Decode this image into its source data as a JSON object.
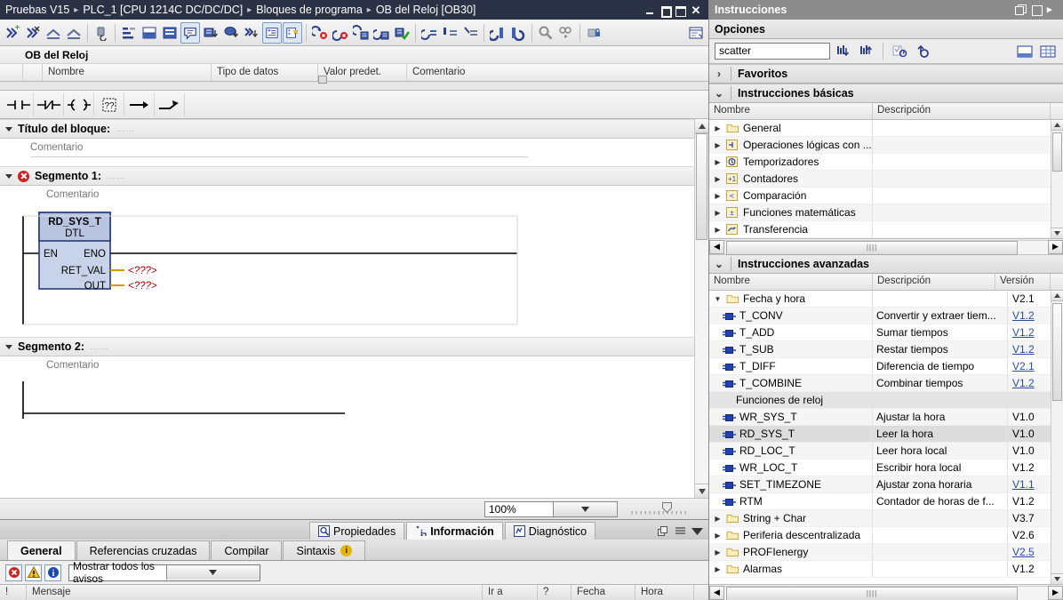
{
  "titlebar": {
    "breadcrumbs": [
      "Pruebas V15",
      "PLC_1 [CPU 1214C DC/DC/DC]",
      "Bloques de programa",
      "OB del Reloj [OB30]"
    ],
    "separator": "▸",
    "controls": [
      {
        "name": "minimize",
        "label": "_"
      },
      {
        "name": "restore",
        "label": ""
      },
      {
        "name": "maximize",
        "label": ""
      },
      {
        "name": "close",
        "label": "✕"
      }
    ]
  },
  "toolbar": {
    "groups": [
      [
        "insert-network-icon",
        "delete-network-icon",
        "up-arrow-network-icon",
        "down-arrow-network-icon"
      ],
      [
        "download-icon"
      ],
      [
        "absolute-symbolic-icon",
        "layout-a-icon",
        "layout-b-icon",
        "comment-toggle-icon",
        "show-disabled-icon",
        "favorites-icon",
        "expand-all-icon",
        "bookmark-icon"
      ],
      [
        "monitor-off-icon",
        "monitor-icon",
        "snapshot-icon",
        "restore-snapshot-icon",
        "modify-icon"
      ],
      [
        "bookmark-prev-icon",
        "bookmark-toggle-icon",
        "bookmark-next-icon"
      ],
      [
        "goto-prev-icon",
        "goto-next-icon"
      ],
      [
        "search-icon",
        "goto-icon"
      ],
      [
        "protect-icon"
      ],
      [
        "properties-icon"
      ]
    ]
  },
  "block": {
    "title": "OB del Reloj",
    "interface_columns": [
      "",
      "",
      "Nombre",
      "Tipo de datos",
      "Valor predet.",
      "Comentario"
    ]
  },
  "lad_tools": [
    {
      "name": "contact-no-icon",
      "label": "-| |-"
    },
    {
      "name": "contact-nc-icon",
      "label": "-|/|-"
    },
    {
      "name": "coil-icon",
      "label": "-( )-"
    },
    {
      "name": "empty-box-icon",
      "label": "??"
    },
    {
      "name": "open-branch-icon",
      "label": "→"
    },
    {
      "name": "close-branch-icon",
      "label": "↗"
    }
  ],
  "editor": {
    "block_title_label": "Título del bloque:",
    "block_comment": "Comentario",
    "dots": "……",
    "networks": [
      {
        "label": "Segmento 1:",
        "comment": "Comentario",
        "has_error": true
      },
      {
        "label": "Segmento 2:",
        "comment": "Comentario",
        "has_error": false
      }
    ],
    "fb": {
      "name": "RD_SYS_T",
      "type": "DTL",
      "left_pins": [
        "EN"
      ],
      "right_pins": [
        "ENO",
        "RET_VAL",
        "OUT"
      ],
      "ret_val_value": "<???>",
      "out_value": "<???>"
    },
    "zoom": {
      "value": "100%"
    }
  },
  "info_panel": {
    "tabs": [
      {
        "label": "Propiedades",
        "icon": "properties-icon",
        "active": false
      },
      {
        "label": "Información",
        "icon": "info-icon",
        "active": true
      },
      {
        "label": "Diagnóstico",
        "icon": "diagnostics-icon",
        "active": false
      }
    ],
    "subtabs": [
      {
        "label": "General",
        "active": true,
        "badge": ""
      },
      {
        "label": "Referencias cruzadas",
        "active": false,
        "badge": ""
      },
      {
        "label": "Compilar",
        "active": false,
        "badge": ""
      },
      {
        "label": "Sintaxis",
        "active": false,
        "badge": "i"
      }
    ],
    "filter_buttons": [
      "error-icon",
      "warning-icon",
      "info-icon"
    ],
    "filter_value": "Mostrar todos los avisos",
    "message_columns": [
      "!",
      "Mensaje",
      "Ir a",
      "?",
      "Fecha",
      "Hora",
      ""
    ]
  },
  "right_panel": {
    "title": "Instrucciones",
    "options_label": "Opciones",
    "search_value": "scatter",
    "search_buttons": [
      "find-down-icon",
      "find-up-icon",
      "filter-icon",
      "refresh-icon"
    ],
    "view_buttons": [
      "view-single-icon",
      "view-table-icon"
    ],
    "sections": [
      {
        "label": "Favoritos",
        "expanded": false
      },
      {
        "label": "Instrucciones básicas",
        "expanded": true
      },
      {
        "label": "Instrucciones avanzadas",
        "expanded": true
      }
    ],
    "basic_columns": [
      "Nombre",
      "Descripción"
    ],
    "basic_rows": [
      {
        "name": "General",
        "desc": "",
        "icon": "folder-icon",
        "kind": "folder"
      },
      {
        "name": "Operaciones lógicas con ...",
        "desc": "",
        "icon": "logic-icon",
        "kind": "folder"
      },
      {
        "name": "Temporizadores",
        "desc": "",
        "icon": "timer-icon",
        "kind": "folder"
      },
      {
        "name": "Contadores",
        "desc": "",
        "icon": "counter-icon",
        "kind": "folder"
      },
      {
        "name": "Comparación",
        "desc": "",
        "icon": "compare-icon",
        "kind": "folder"
      },
      {
        "name": "Funciones matemáticas",
        "desc": "",
        "icon": "math-icon",
        "kind": "folder"
      },
      {
        "name": "Transferencia",
        "desc": "",
        "icon": "move-icon",
        "kind": "folder"
      }
    ],
    "adv_columns": [
      "Nombre",
      "Descripción",
      "Versión"
    ],
    "adv_rows": [
      {
        "name": "Fecha y hora",
        "desc": "",
        "version": "V2.1",
        "kind": "folder-open",
        "indent": 0,
        "link": false,
        "selected": false
      },
      {
        "name": "T_CONV",
        "desc": "Convertir y extraer tiem...",
        "version": "V1.2",
        "kind": "fn",
        "indent": 1,
        "link": true,
        "selected": false
      },
      {
        "name": "T_ADD",
        "desc": "Sumar tiempos",
        "version": "V1.2",
        "kind": "fn",
        "indent": 1,
        "link": true,
        "selected": false
      },
      {
        "name": "T_SUB",
        "desc": "Restar tiempos",
        "version": "V1.2",
        "kind": "fn",
        "indent": 1,
        "link": true,
        "selected": false
      },
      {
        "name": "T_DIFF",
        "desc": "Diferencia de tiempo",
        "version": "V2.1",
        "kind": "fn",
        "indent": 1,
        "link": true,
        "selected": false
      },
      {
        "name": "T_COMBINE",
        "desc": "Combinar tiempos",
        "version": "V1.2",
        "kind": "fn",
        "indent": 1,
        "link": true,
        "selected": false
      },
      {
        "name": "Funciones de reloj",
        "desc": "",
        "version": "",
        "kind": "group",
        "indent": 1,
        "link": false,
        "selected": false
      },
      {
        "name": "WR_SYS_T",
        "desc": "Ajustar la hora",
        "version": "V1.0",
        "kind": "fn",
        "indent": 1,
        "link": false,
        "selected": false
      },
      {
        "name": "RD_SYS_T",
        "desc": "Leer la hora",
        "version": "V1.0",
        "kind": "fn",
        "indent": 1,
        "link": false,
        "selected": true
      },
      {
        "name": "RD_LOC_T",
        "desc": "Leer hora local",
        "version": "V1.0",
        "kind": "fn",
        "indent": 1,
        "link": false,
        "selected": false
      },
      {
        "name": "WR_LOC_T",
        "desc": "Escribir hora local",
        "version": "V1.2",
        "kind": "fn",
        "indent": 1,
        "link": false,
        "selected": false
      },
      {
        "name": "SET_TIMEZONE",
        "desc": "Ajustar zona horaria",
        "version": "V1.1",
        "kind": "fn",
        "indent": 1,
        "link": true,
        "selected": false
      },
      {
        "name": "RTM",
        "desc": "Contador de horas de f...",
        "version": "V1.2",
        "kind": "fn",
        "indent": 1,
        "link": false,
        "selected": false
      },
      {
        "name": "String + Char",
        "desc": "",
        "version": "V3.7",
        "kind": "folder",
        "indent": 0,
        "link": false,
        "selected": false
      },
      {
        "name": "Periferia descentralizada",
        "desc": "",
        "version": "V2.6",
        "kind": "folder",
        "indent": 0,
        "link": false,
        "selected": false
      },
      {
        "name": "PROFIenergy",
        "desc": "",
        "version": "V2.5",
        "kind": "folder",
        "indent": 0,
        "link": true,
        "selected": false
      },
      {
        "name": "Alarmas",
        "desc": "",
        "version": "V1.2",
        "kind": "folder",
        "indent": 0,
        "link": false,
        "selected": false
      }
    ]
  },
  "colors": {
    "titlebar_bg": "#2b3245",
    "panel_title_bg": "#8c8c8c",
    "error_red": "#cc2222",
    "fb_fill": "#c8d2e8",
    "fb_border": "#243a7a",
    "placeholder_red": "#aa0000",
    "pin_wire": "#d89a00",
    "link_blue": "#2a4ea8",
    "selection_gray": "#dcdcdc"
  }
}
